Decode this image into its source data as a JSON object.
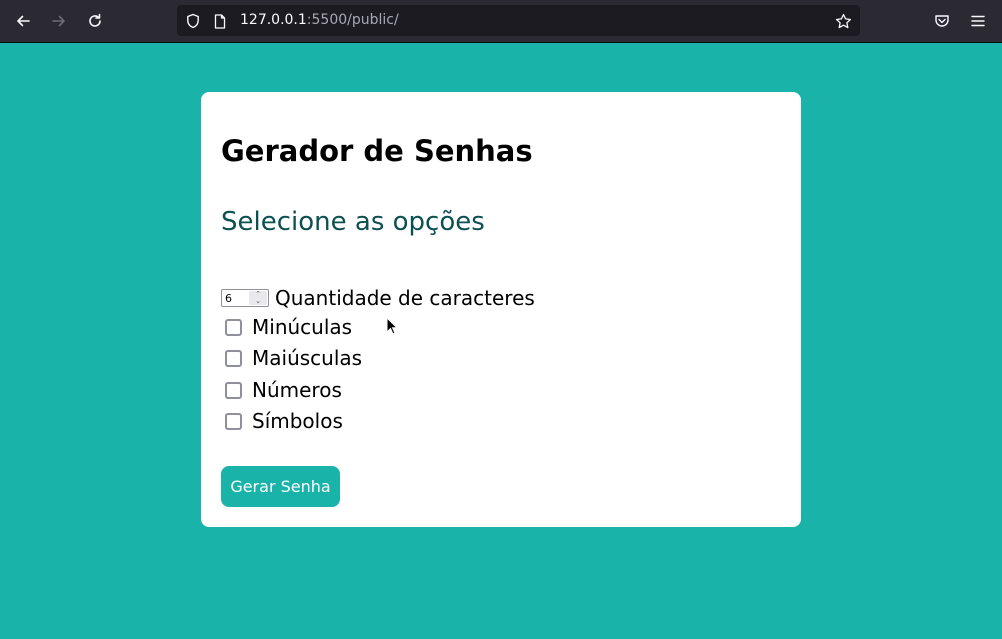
{
  "browser": {
    "url_host": "127.0.0.1",
    "url_rest": ":5500/public/",
    "icons": [
      "back-arrow-icon",
      "forward-arrow-icon",
      "reload-icon",
      "shield-icon",
      "page-icon",
      "bookmark-star-icon",
      "pocket-icon",
      "hamburger-menu-icon"
    ]
  },
  "page": {
    "title": "Gerador de Senhas",
    "subtitle": "Selecione as opções",
    "quantity": {
      "value": "6",
      "label": "Quantidade de caracteres"
    },
    "options": [
      {
        "label": "Minúculas",
        "checked": false
      },
      {
        "label": "Maiúsculas",
        "checked": false
      },
      {
        "label": "Números",
        "checked": false
      },
      {
        "label": "Símbolos",
        "checked": false
      }
    ],
    "button_label": "Gerar Senha"
  },
  "colors": {
    "background": "#19b3a9",
    "card": "#ffffff",
    "subtitle": "#0d5052",
    "button": "#19b3a9",
    "toolbar": "#2b2a33"
  }
}
